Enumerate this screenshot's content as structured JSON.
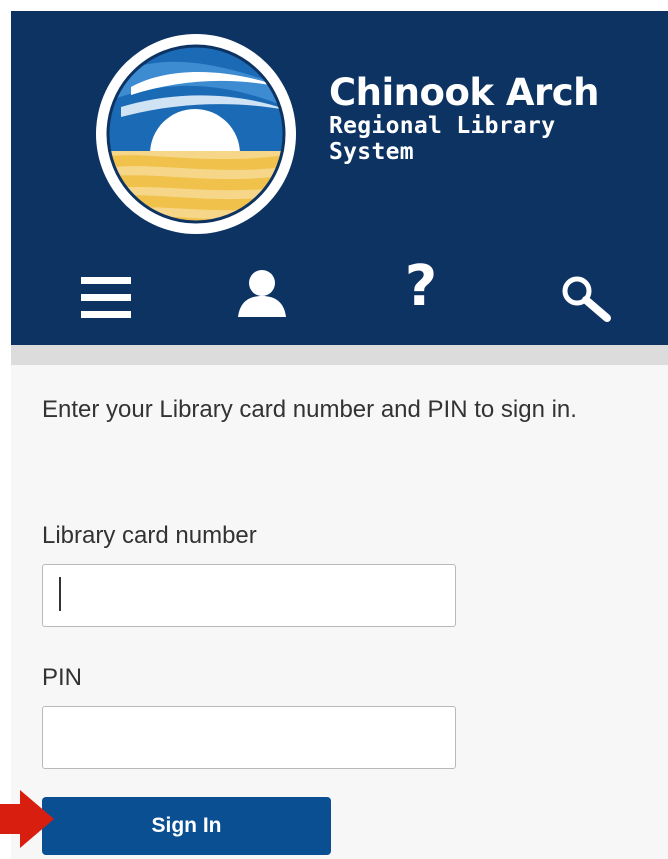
{
  "header": {
    "brand_title": "Chinook Arch",
    "brand_line_1": "Regional Library",
    "brand_line_2": "System",
    "background_color": "#0d3363"
  },
  "nav": {
    "icons": [
      "menu-icon",
      "account-icon",
      "help-icon",
      "search-icon"
    ],
    "help_glyph": "?"
  },
  "login": {
    "instructions": "Enter your Library card number and PIN to sign in.",
    "card_number_label": "Library card number",
    "card_number_value": "",
    "pin_label": "PIN",
    "pin_value": "",
    "sign_in_label": "Sign In",
    "button_color": "#0b4f93"
  },
  "annotation": {
    "arrow_color": "#d81e0f",
    "points_to": "sign-in-button"
  }
}
